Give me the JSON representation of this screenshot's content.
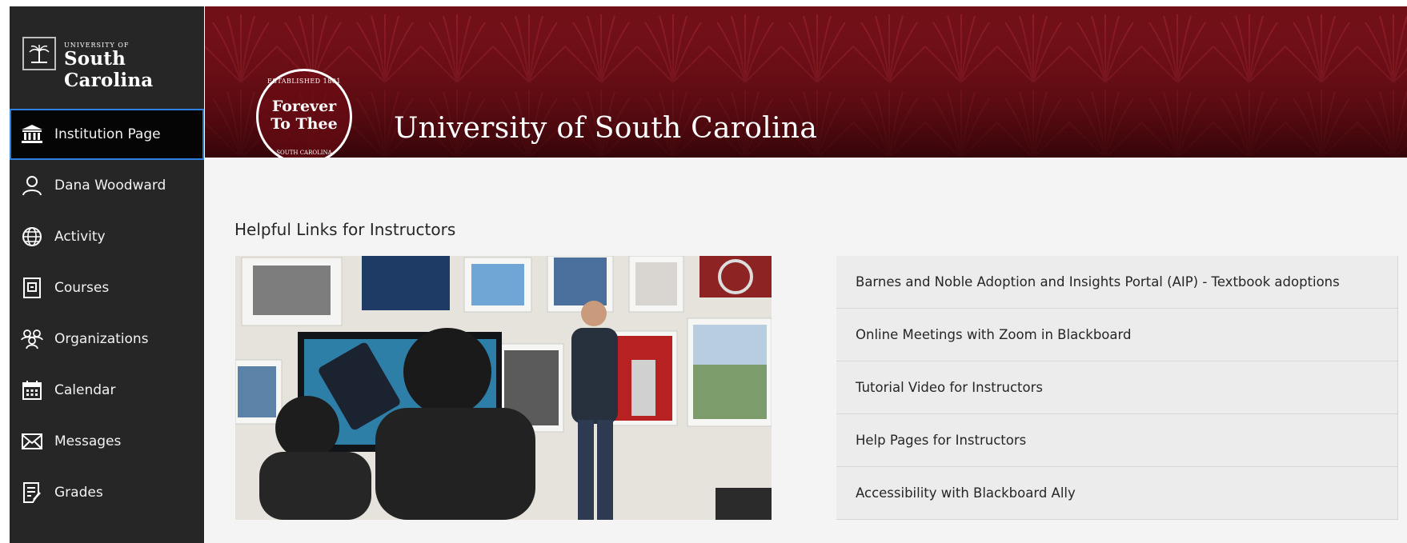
{
  "brand": {
    "small": "UNIVERSITY OF",
    "name": "South Carolina"
  },
  "nav": [
    {
      "label": "Institution Page",
      "icon": "institution-icon",
      "active": true
    },
    {
      "label": "Dana Woodward",
      "icon": "user-icon"
    },
    {
      "label": "Activity",
      "icon": "globe-icon"
    },
    {
      "label": "Courses",
      "icon": "courses-icon"
    },
    {
      "label": "Organizations",
      "icon": "organizations-icon"
    },
    {
      "label": "Calendar",
      "icon": "calendar-icon"
    },
    {
      "label": "Messages",
      "icon": "envelope-icon"
    },
    {
      "label": "Grades",
      "icon": "grades-icon"
    }
  ],
  "banner": {
    "seal_top": "ESTABLISHED 1801",
    "seal_line1": "Forever",
    "seal_line2": "To Thee",
    "seal_bottom": "SOUTH CAROLINA",
    "title": "University of South Carolina"
  },
  "main": {
    "heading": "Helpful Links for Instructors",
    "links": [
      "Barnes and Noble Adoption and Insights Portal (AIP) - Textbook adoptions",
      "Online Meetings with Zoom in Blackboard",
      "Tutorial Video for Instructors",
      "Help Pages for Instructors",
      "Accessibility with Blackboard Ally"
    ]
  },
  "colors": {
    "sidebar": "#262626",
    "banner": "#6e0c14",
    "active_outline": "#2f7fe0"
  }
}
